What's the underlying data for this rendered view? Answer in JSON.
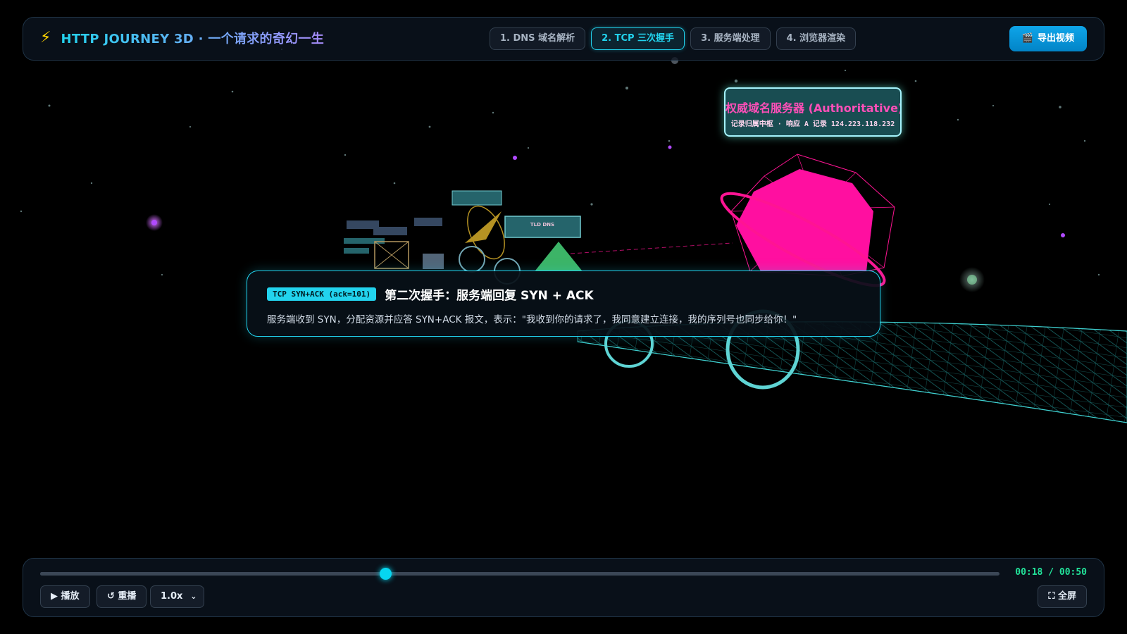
{
  "header": {
    "bolt_icon": "⚡",
    "title": "HTTP JOURNEY 3D · 一个请求的奇幻一生",
    "tabs": [
      {
        "label": "1. DNS 域名解析",
        "active": false
      },
      {
        "label": "2. TCP 三次握手",
        "active": true
      },
      {
        "label": "3. 服务端处理",
        "active": false
      },
      {
        "label": "4. 浏览器渲染",
        "active": false
      }
    ],
    "export_icon": "🎬",
    "export_label": "导出视频"
  },
  "scene_label": {
    "title": "权威域名服务器 (Authoritative)",
    "subtitle": "记录归属中枢 · 响应 A 记录 124.223.118.232"
  },
  "info": {
    "badge": "TCP SYN+ACK (ack=101)",
    "title": "第二次握手：服务端回复 SYN + ACK",
    "description": "服务端收到 SYN，分配资源并应答 SYN+ACK 报文，表示：\"我收到你的请求了，我同意建立连接，我的序列号也同步给你！\""
  },
  "player": {
    "progress": 0.36,
    "time": "00:18 / 00:50",
    "play_label": "▶ 播放",
    "replay_label": "↺ 重播",
    "speed_value": "1.0x",
    "speed_chevron": "⌄",
    "fullscreen_label": "⛶ 全屏"
  },
  "colors": {
    "accent": "#22d3ee",
    "accent_purple": "#a78bfa",
    "time_green": "#22e39a",
    "magenta": "#ff1493"
  }
}
